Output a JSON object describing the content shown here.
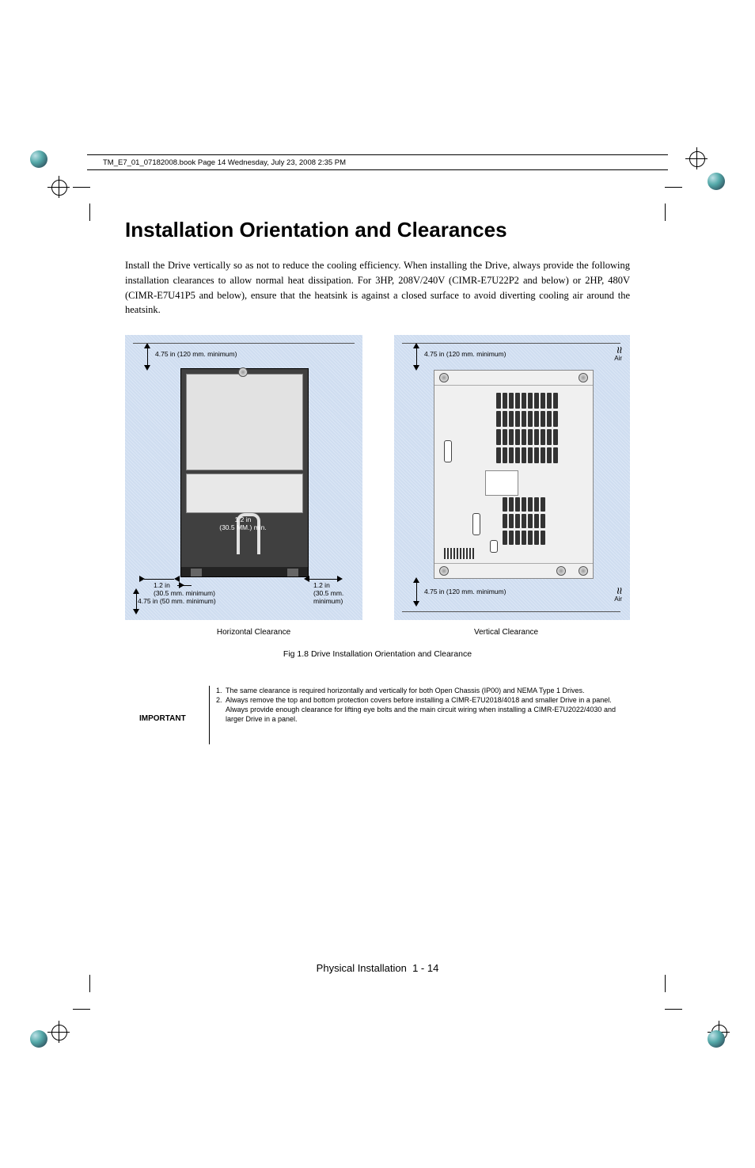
{
  "meta": {
    "header_line": "TM_E7_01_07182008.book  Page 14  Wednesday, July 23, 2008  2:35 PM"
  },
  "content": {
    "heading": "Installation Orientation and Clearances",
    "paragraph": "Install the Drive vertically so as not to reduce the cooling efficiency. When installing the Drive, always provide the following installation clearances to allow normal heat dissipation. For 3HP, 208V/240V (CIMR-E7U22P2 and below) or 2HP, 480V (CIMR-E7U41P5 and below), ensure that the heatsink is against a closed surface to avoid diverting cooling air around the heatsink."
  },
  "figure": {
    "left": {
      "top_clearance": "4.75 in (120 mm. minimum)",
      "center_label_1": "1.2 in",
      "center_label_2": "(30.5 MM.) min.",
      "left_arrow_1": "1.2 in",
      "left_arrow_2": "(30.5 mm. minimum)",
      "left_arrow_3": "4.75 in (50 mm. minimum)",
      "right_arrow_1": "1.2 in",
      "right_arrow_2": "(30.5 mm. minimum)",
      "caption": "Horizontal Clearance"
    },
    "right": {
      "top_clearance": "4.75 in (120 mm. minimum)",
      "bottom_clearance": "4.75 in (120 mm. minimum)",
      "air_top": "Air",
      "air_bottom": "Air",
      "caption": "Vertical Clearance"
    },
    "caption": "Fig 1.8  Drive Installation Orientation and Clearance"
  },
  "important": {
    "label": "IMPORTANT",
    "items": [
      {
        "num": "1.",
        "text": "The same clearance is required horizontally and vertically for both Open Chassis (IP00) and NEMA Type 1 Drives."
      },
      {
        "num": "2.",
        "text": "Always remove the top and bottom protection covers before installing a CIMR-E7U2018/4018 and smaller Drive in a panel."
      },
      {
        "num": "",
        "text": "Always provide enough clearance for lifting eye bolts and the main circuit wiring when installing a CIMR-E7U2022/4030 and larger Drive in a panel."
      }
    ]
  },
  "footer": {
    "text_left": "Physical Installation",
    "text_right": "1 - 14"
  }
}
